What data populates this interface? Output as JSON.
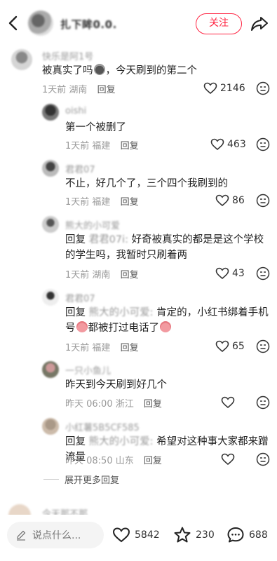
{
  "header": {
    "author_name": "扎下眸0.0.",
    "follow_label": "关注"
  },
  "comments": [
    {
      "name": "快乐是阿1号",
      "text": "被真实了吗",
      "text2": "，今天刷到的第二个",
      "time": "1天前",
      "location": "湖南",
      "reply_label": "回复",
      "likes": "2146"
    }
  ],
  "replies": [
    {
      "name": "oishi",
      "text": "第一个被删了",
      "time": "1天前",
      "location": "福建",
      "reply_label": "回复",
      "likes": "463"
    },
    {
      "name": "君君07",
      "text": "不止，好几个了，三个四个我刷到的",
      "time": "1天前",
      "location": "福建",
      "reply_label": "回复",
      "likes": "86"
    },
    {
      "name": "熊大的小可爱",
      "reply_prefix": "回复",
      "reply_to": "君君07i:",
      "text": "好奇被真实的都是是这个学校的学生吗，我暂时只刷着两",
      "time": "1天前",
      "location": "湖南",
      "reply_label": "回复",
      "likes": "43"
    },
    {
      "name": "君君07",
      "reply_prefix": "回复",
      "reply_to": "熊大的小可爱:",
      "text_a": "肯定的，小红书绑着手机号",
      "text_b": "都被打过电话了",
      "time": "1天前",
      "location": "福建",
      "reply_label": "回复",
      "likes": "65"
    },
    {
      "name": "一只小鱼儿",
      "text": "昨天到今天刷到好几个",
      "time": "昨天 06:00",
      "location": "浙江",
      "reply_label": "回复",
      "likes": ""
    },
    {
      "name": "小红薯5B5CF585",
      "reply_prefix": "回复",
      "reply_to": "熊大的小可爱:",
      "text": "希望对这种事大家都来蹭流量",
      "time": "昨天 08:50",
      "location": "山东",
      "reply_label": "回复",
      "likes": ""
    }
  ],
  "expand_label": "展开更多回复",
  "next_comment_name": "今天那不那",
  "bottom_bar": {
    "input_placeholder": "说点什么...",
    "likes": "5842",
    "stars": "230",
    "comments": "688"
  }
}
